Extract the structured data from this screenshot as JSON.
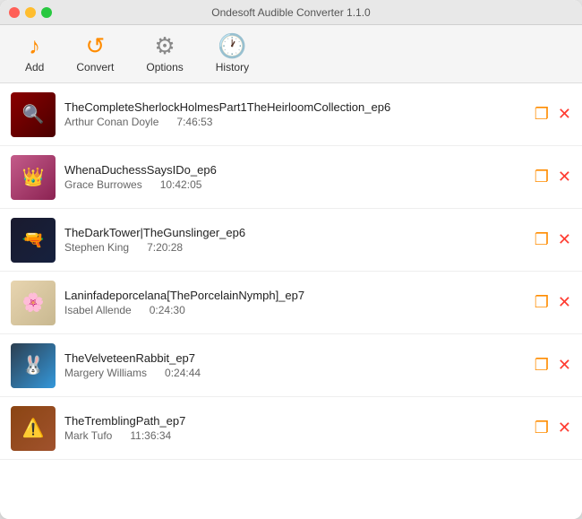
{
  "window": {
    "title": "Ondesoft Audible Converter 1.1.0"
  },
  "toolbar": {
    "add_label": "Add",
    "convert_label": "Convert",
    "options_label": "Options",
    "history_label": "History"
  },
  "books": [
    {
      "id": 1,
      "title": "TheCompleteSherlockHolmesPart1TheHeirloomCollection_ep6",
      "author": "Arthur Conan Doyle",
      "duration": "7:46:53",
      "cover_class": "cover-1",
      "cover_emoji": "🔍"
    },
    {
      "id": 2,
      "title": "WhenaDuchessSaysIDo_ep6",
      "author": "Grace Burrowes",
      "duration": "10:42:05",
      "cover_class": "cover-2",
      "cover_emoji": "👑"
    },
    {
      "id": 3,
      "title": "TheDarkTower|TheGunslinger_ep6",
      "author": "Stephen King",
      "duration": "7:20:28",
      "cover_class": "cover-3",
      "cover_emoji": "🔫"
    },
    {
      "id": 4,
      "title": "Laninfadeporcelana[ThePorcelainNymph]_ep7",
      "author": "Isabel Allende",
      "duration": "0:24:30",
      "cover_class": "cover-4",
      "cover_emoji": "🌸"
    },
    {
      "id": 5,
      "title": "TheVelveteenRabbit_ep7",
      "author": "Margery Williams",
      "duration": "0:24:44",
      "cover_class": "cover-5",
      "cover_emoji": "🐰"
    },
    {
      "id": 6,
      "title": "TheTremblingPath_ep7",
      "author": "Mark Tufo",
      "duration": "11:36:34",
      "cover_class": "cover-6",
      "cover_emoji": "⚠️"
    }
  ]
}
